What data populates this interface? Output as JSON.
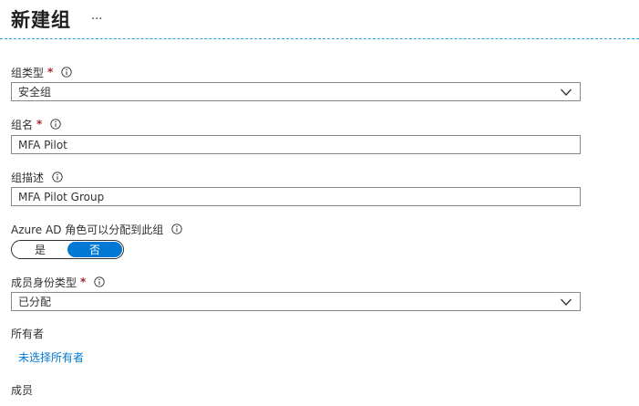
{
  "header": {
    "title": "新建组",
    "more_label": "···"
  },
  "form": {
    "group_type": {
      "label": "组类型",
      "required_mark": "*",
      "value": "安全组",
      "info_icon": "info-icon",
      "chevron_icon": "chevron-down-icon"
    },
    "group_name": {
      "label": "组名",
      "required_mark": "*",
      "value": "MFA Pilot",
      "info_icon": "info-icon"
    },
    "group_description": {
      "label": "组描述",
      "value": "MFA Pilot Group",
      "info_icon": "info-icon"
    },
    "azure_ad_roles": {
      "label": "Azure AD 角色可以分配到此组",
      "options": [
        "是",
        "否"
      ],
      "selected": "否",
      "info_icon": "info-icon"
    },
    "membership_type": {
      "label": "成员身份类型",
      "required_mark": "*",
      "value": "已分配",
      "info_icon": "info-icon",
      "chevron_icon": "chevron-down-icon"
    },
    "owners": {
      "label": "所有者",
      "link": "未选择所有者"
    },
    "members": {
      "label": "成员"
    }
  },
  "colors": {
    "accent": "#0078d4",
    "required": "#a4262c",
    "divider": "#2b9fd8",
    "border": "#8a8886"
  }
}
